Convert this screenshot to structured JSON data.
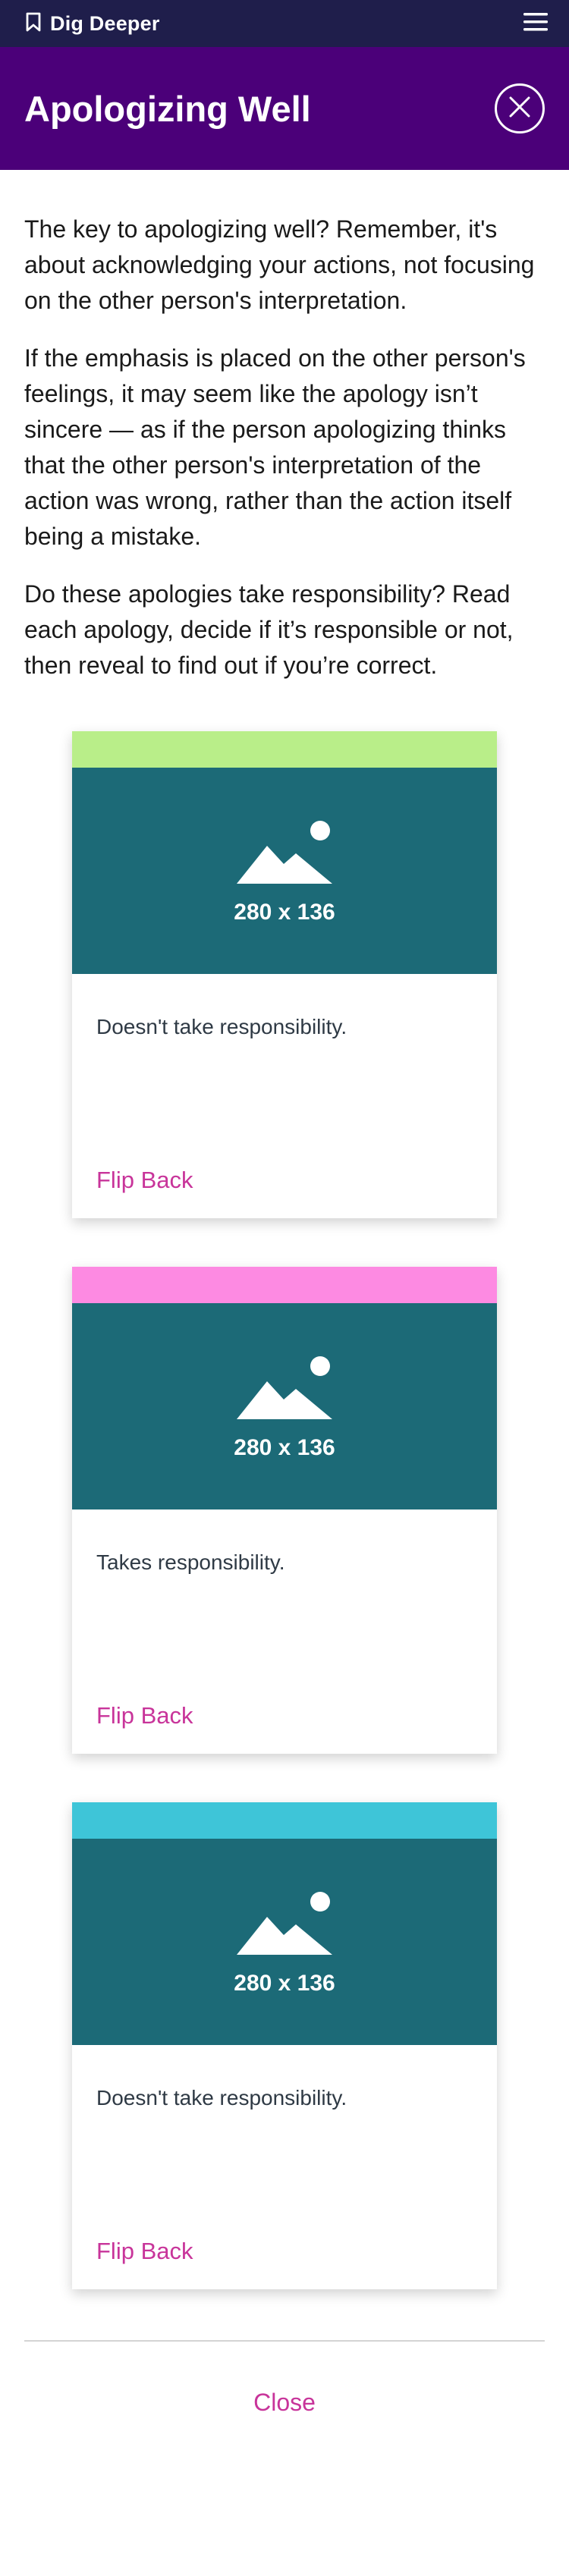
{
  "topbar": {
    "label": "Dig Deeper",
    "bookmark_icon": "bookmark-icon",
    "menu_icon": "hamburger-menu-icon"
  },
  "header": {
    "title": "Apologizing Well",
    "close_icon": "close-icon"
  },
  "intro": {
    "paragraphs": [
      "The key to apologizing well? Remember, it's about acknowledging your actions, not focusing on the other person's interpretation.",
      "If the emphasis is placed on the other person's feelings, it may seem like the apology isn’t sincere — as if the person apologizing thinks that the other person's interpretation of the action was wrong, rather than the action itself being a mistake.",
      "Do these apologies take responsibility? Read each apology, decide if it’s responsible or not, then reveal to find out if you’re correct."
    ]
  },
  "cards": [
    {
      "stripe_color": "#b9ee89",
      "image_label": "280 x 136",
      "image_icon": "image-placeholder-icon",
      "text": "Doesn't take responsibility.",
      "flip_label": "Flip Back"
    },
    {
      "stripe_color": "#fd8ae2",
      "image_label": "280 x 136",
      "image_icon": "image-placeholder-icon",
      "text": "Takes responsibility.",
      "flip_label": "Flip Back"
    },
    {
      "stripe_color": "#3ec5d8",
      "image_label": "280 x 136",
      "image_icon": "image-placeholder-icon",
      "text": "Doesn't take responsibility.",
      "flip_label": "Flip Back"
    }
  ],
  "footer": {
    "close_label": "Close"
  },
  "colors": {
    "topbar": "#1f1e4b",
    "header": "#4b0079",
    "image_bg": "#1c6a77",
    "accent": "#c8349a"
  }
}
